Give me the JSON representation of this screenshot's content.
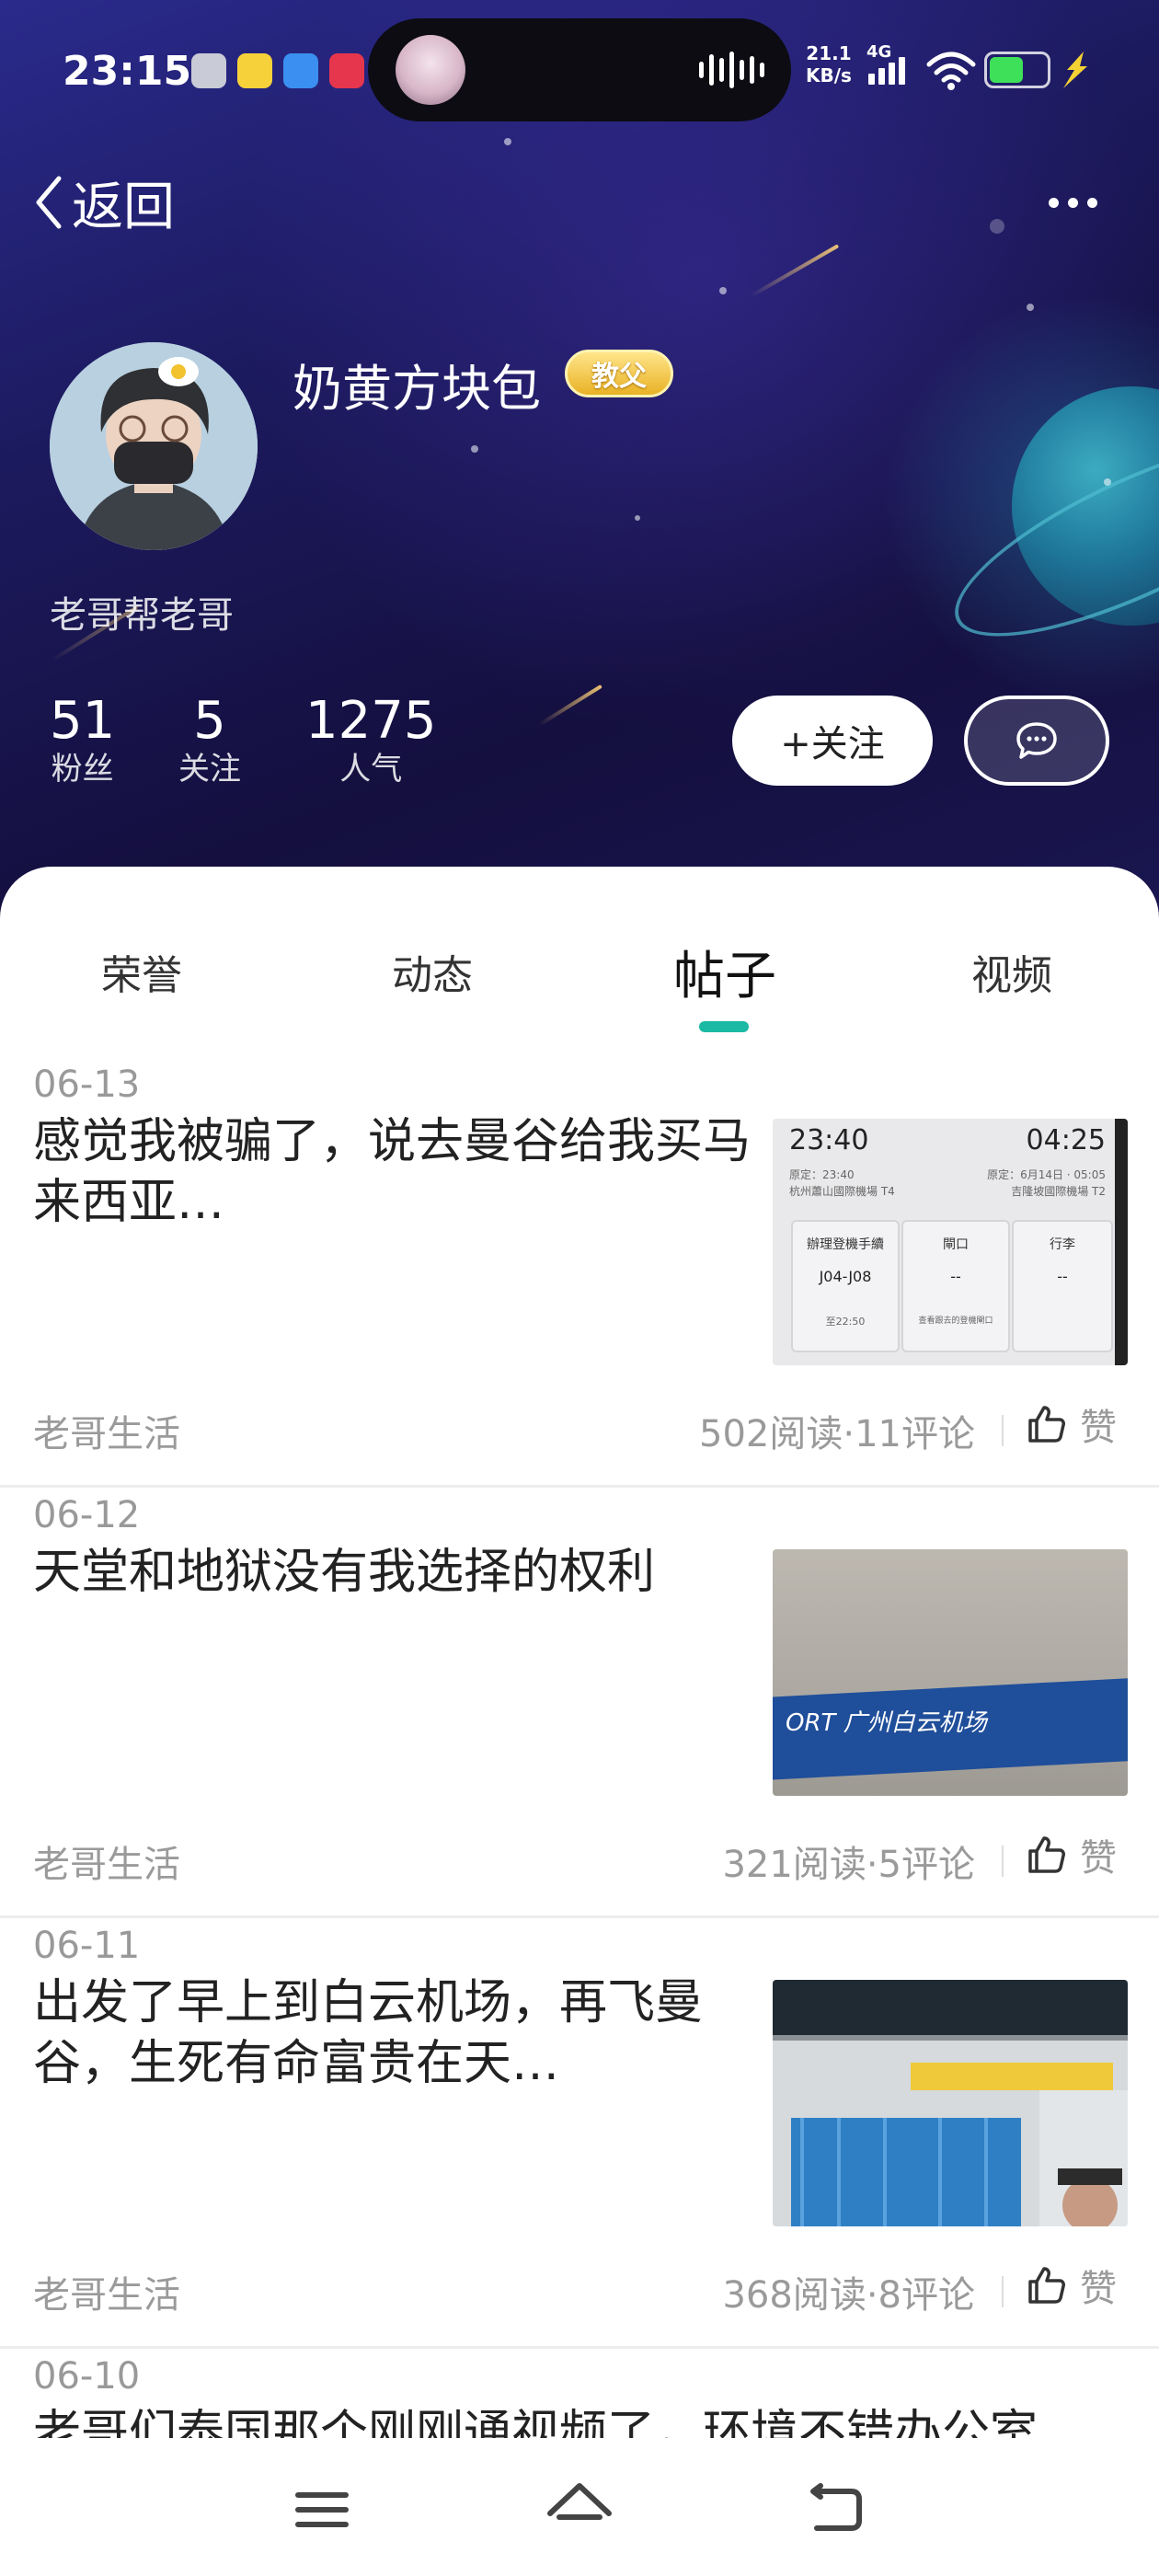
{
  "status_bar": {
    "time": "23:15",
    "net_speed_value": "21.1",
    "net_speed_unit": "KB/s",
    "network_type": "4G",
    "battery_level": 0.6,
    "icons": [
      "app-icon-1",
      "app-icon-2",
      "app-icon-3",
      "app-icon-4",
      "wifi-icon",
      "signal-icon",
      "battery-icon",
      "bolt-icon"
    ]
  },
  "nav": {
    "back_label": "返回"
  },
  "profile": {
    "username": "奶黄方块包",
    "rank_badge": "教父",
    "signature": "老哥帮老哥",
    "stats": [
      {
        "value": "51",
        "label": "粉丝"
      },
      {
        "value": "5",
        "label": "关注"
      },
      {
        "value": "1275",
        "label": "人气"
      }
    ],
    "follow_label": "+关注"
  },
  "tabs": [
    {
      "label": "荣誉",
      "active": false
    },
    {
      "label": "动态",
      "active": false
    },
    {
      "label": "帖子",
      "active": true
    },
    {
      "label": "视频",
      "active": false
    }
  ],
  "posts": [
    {
      "date": "06-13",
      "title": "感觉我被骗了，说去曼谷给我买马来西亚…",
      "category": "老哥生活",
      "stats": "502阅读·11评论",
      "like_label": "赞",
      "thumb": {
        "depart_time": "23:40",
        "arrive_time": "04:25",
        "depart_plan": "原定：23:40",
        "arrive_plan": "原定：6月14日 · 05:05",
        "depart_airport": "杭州蕭山國際機場 T4",
        "arrive_airport": "吉隆坡國際機場 T2",
        "card1_title": "辦理登機手續",
        "card1_value": "J04-J08",
        "card1_note": "至22:50",
        "card2_title": "閘口",
        "card2_value": "--",
        "card2_note": "查看跟去的登機閘口",
        "card3_title": "行李",
        "card3_value": "--"
      }
    },
    {
      "date": "06-12",
      "title": "天堂和地狱没有我选择的权利",
      "category": "老哥生活",
      "stats": "321阅读·5评论",
      "like_label": "赞",
      "thumb": {
        "sign_text": "ORT 广州白云机场"
      }
    },
    {
      "date": "06-11",
      "title": "出发了早上到白云机场，再飞曼谷，生死有命富贵在天…",
      "category": "老哥生活",
      "stats": "368阅读·8评论",
      "like_label": "赞"
    },
    {
      "date": "06-10",
      "title": "老哥们泰国那个刚刚通视频了，环境不错办公室",
      "category": "",
      "stats": "",
      "like_label": ""
    }
  ],
  "bottom_nav": [
    "menu-icon",
    "home-icon",
    "back-icon"
  ]
}
